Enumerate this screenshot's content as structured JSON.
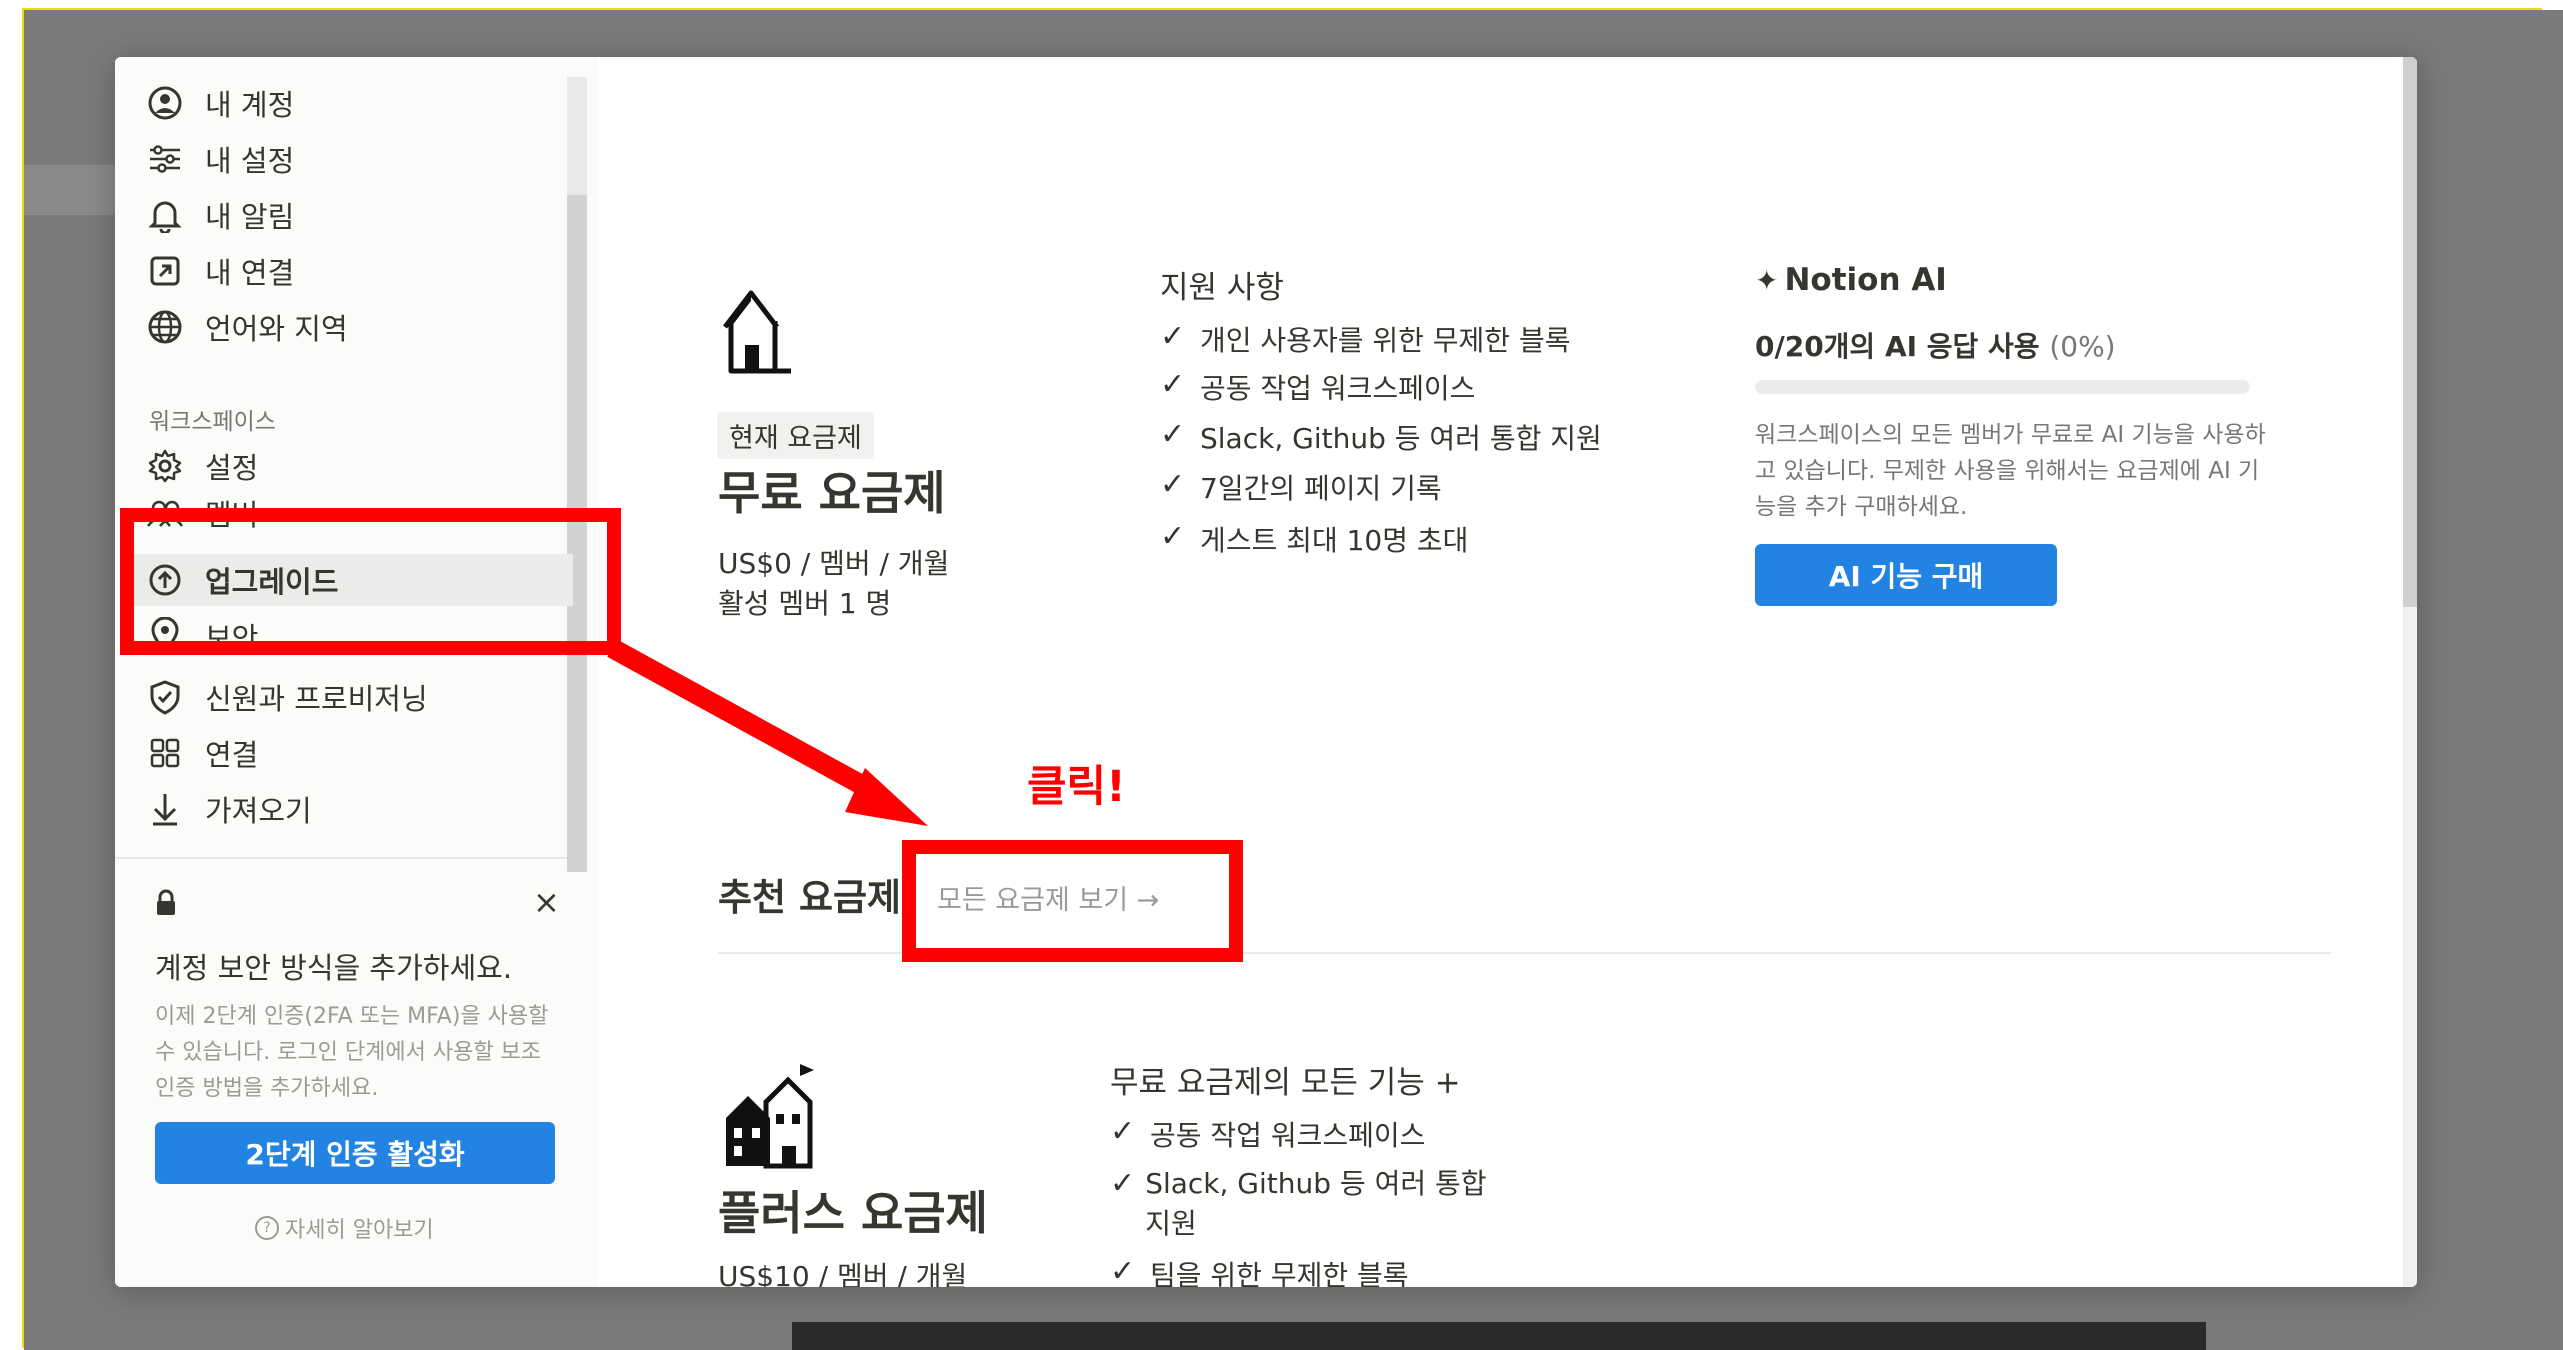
{
  "sidebar": {
    "account_items": [
      {
        "label": "내 계정",
        "icon": "account-icon"
      },
      {
        "label": "내 설정",
        "icon": "sliders-icon"
      },
      {
        "label": "내 알림",
        "icon": "bell-icon"
      },
      {
        "label": "내 연결",
        "icon": "link-out-icon"
      },
      {
        "label": "언어와 지역",
        "icon": "globe-icon"
      }
    ],
    "workspace_section": "워크스페이스",
    "workspace_items": [
      {
        "label": "설정",
        "icon": "gear-icon"
      },
      {
        "label": "멤버",
        "icon": "members-icon"
      },
      {
        "label": "업그레이드",
        "icon": "upgrade-icon"
      },
      {
        "label": "보안",
        "icon": "location-icon"
      },
      {
        "label": "신원과 프로비저닝",
        "icon": "shield-icon"
      },
      {
        "label": "연결",
        "icon": "grid-icon"
      },
      {
        "label": "가져오기",
        "icon": "import-icon"
      }
    ],
    "security": {
      "title": "계정 보안 방식을 추가하세요.",
      "description": "이제 2단계 인증(2FA 또는 MFA)을 사용할 수 있습니다. 로그인 단계에서 사용할 보조 인증 방법을 추가하세요.",
      "button": "2단계 인증 활성화",
      "learn_more": "자세히 알아보기",
      "close": "×"
    }
  },
  "current_plan": {
    "badge": "현재 요금제",
    "title": "무료 요금제",
    "price": "US$0 / 멤버 / 개월",
    "members": "활성 멤버 1 명"
  },
  "support": {
    "title": "지원 사항",
    "features": [
      "개인 사용자를 위한 무제한 블록",
      "공동 작업 워크스페이스",
      "Slack, Github 등 여러 통합 지원",
      "7일간의 페이지 기록",
      "게스트 최대 10명 초대"
    ]
  },
  "ai": {
    "title": "Notion AI",
    "usage": "0/20개의 AI 응답 사용",
    "usage_pct": "(0%)",
    "progress": 0,
    "description": "워크스페이스의 모든 멤버가 무료로 AI 기능을 사용하고 있습니다. 무제한 사용을 위해서는 요금제에 AI 기능을 추가 구매하세요.",
    "button": "AI 기능 구매"
  },
  "recommended": {
    "title": "추천 요금제",
    "view_all": "모든 요금제 보기 →"
  },
  "plus_plan": {
    "title": "플러스 요금제",
    "price": "US$10 / 멤버 / 개월",
    "features_title": "무료 요금제의 모든 기능 +",
    "features": [
      "공동 작업 워크스페이스",
      "Slack, Github 등 여러 통합 지원",
      "팀을 위한 무제한 블록"
    ]
  },
  "annotation": {
    "text": "클릭!",
    "color": "#ff0000"
  },
  "colors": {
    "accent": "#2383e2",
    "annotation": "#ff0000"
  }
}
